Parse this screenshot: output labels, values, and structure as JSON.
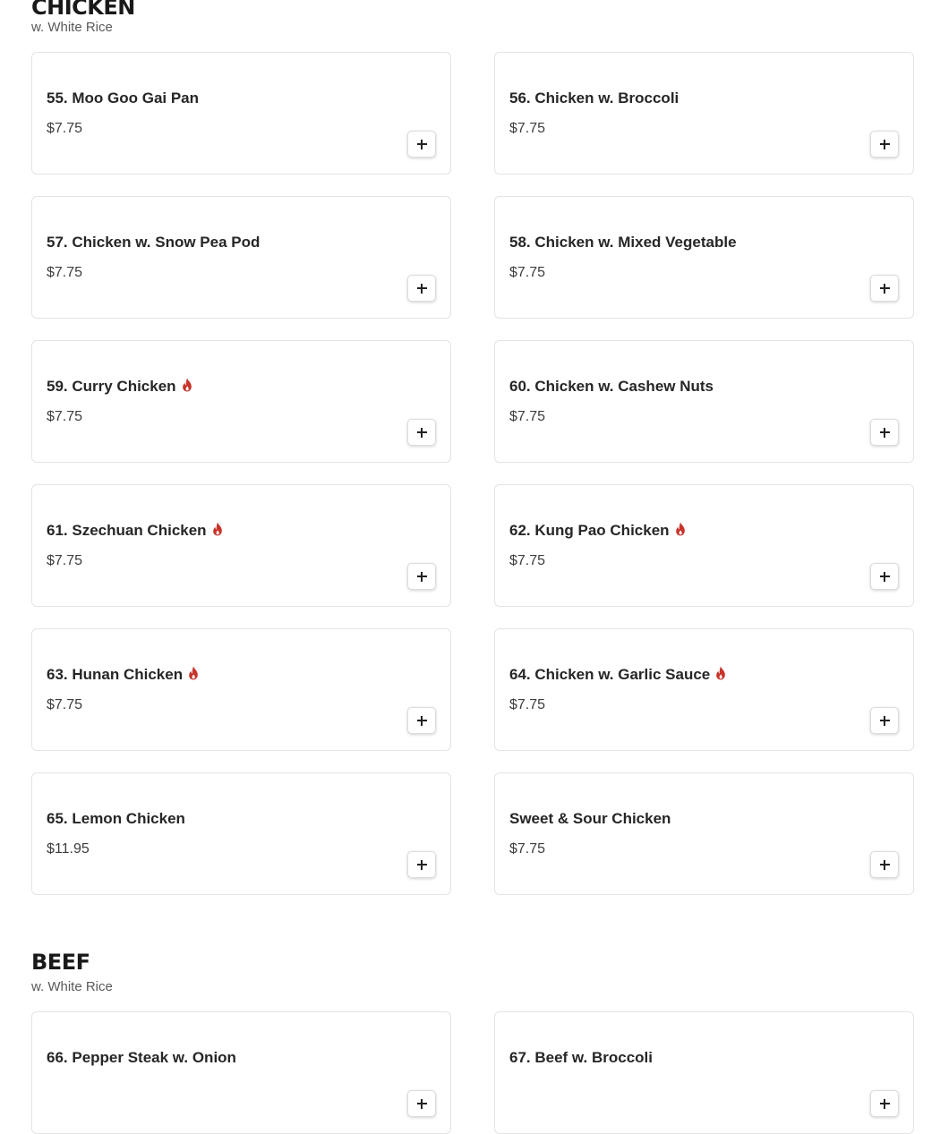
{
  "colors": {
    "spicy": "#c8342b",
    "card_border": "#e4e4e4",
    "heading": "#191919",
    "subtitle": "#595959"
  },
  "sections": [
    {
      "title": "CHICKEN",
      "subtitle": "w. White Rice",
      "items": [
        {
          "name": "55. Moo Goo Gai Pan",
          "price": "$7.75",
          "spicy": false
        },
        {
          "name": "56. Chicken w. Broccoli",
          "price": "$7.75",
          "spicy": false
        },
        {
          "name": "57. Chicken w. Snow Pea Pod",
          "price": "$7.75",
          "spicy": false
        },
        {
          "name": "58. Chicken w. Mixed Vegetable",
          "price": "$7.75",
          "spicy": false
        },
        {
          "name": "59. Curry Chicken",
          "price": "$7.75",
          "spicy": true
        },
        {
          "name": "60. Chicken w. Cashew Nuts",
          "price": "$7.75",
          "spicy": false
        },
        {
          "name": "61. Szechuan Chicken",
          "price": "$7.75",
          "spicy": true
        },
        {
          "name": "62. Kung Pao Chicken",
          "price": "$7.75",
          "spicy": true
        },
        {
          "name": "63. Hunan Chicken",
          "price": "$7.75",
          "spicy": true
        },
        {
          "name": "64. Chicken w. Garlic Sauce",
          "price": "$7.75",
          "spicy": true
        },
        {
          "name": "65. Lemon Chicken",
          "price": "$11.95",
          "spicy": false
        },
        {
          "name": "Sweet & Sour Chicken",
          "price": "$7.75",
          "spicy": false
        }
      ]
    },
    {
      "title": "BEEF",
      "subtitle": "w. White Rice",
      "items": [
        {
          "name": "66. Pepper Steak w. Onion",
          "price": "",
          "spicy": false
        },
        {
          "name": "67. Beef w. Broccoli",
          "price": "",
          "spicy": false
        }
      ]
    }
  ],
  "icons": {
    "spicy": "flame-icon",
    "add": "plus-icon"
  }
}
